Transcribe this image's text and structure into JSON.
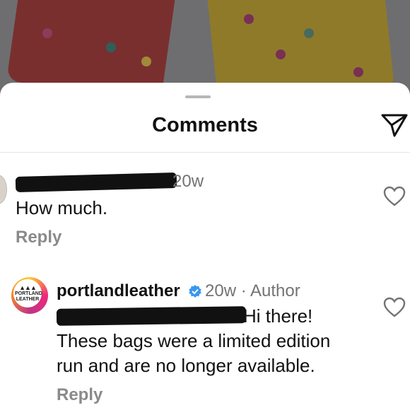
{
  "header": {
    "title": "Comments"
  },
  "comments": [
    {
      "time": "20w",
      "text": "How much.",
      "reply_label": "Reply"
    },
    {
      "username": "portlandleather",
      "meta": "20w · Author",
      "text_line1": "Hi there!",
      "text_line2": "These bags were a limited edition",
      "text_line3": "run and are no longer available.",
      "reply_label": "Reply",
      "avatar_logo": "PORTLAND LEATHER"
    }
  ],
  "colors": {
    "text_primary": "#111111",
    "text_secondary": "#737373",
    "verified_blue": "#3897f0"
  },
  "icons": [
    "send-icon",
    "heart-icon",
    "verified-badge-icon"
  ]
}
